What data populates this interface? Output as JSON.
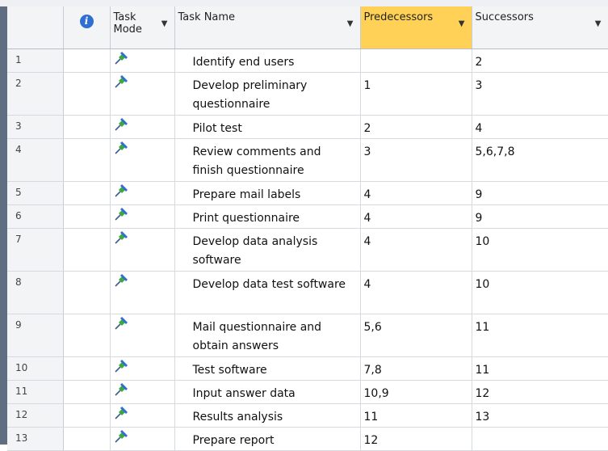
{
  "columns": {
    "task_mode": "Task Mode",
    "task_name": "Task Name",
    "predecessors": "Predecessors",
    "successors": "Successors"
  },
  "icons": {
    "header_info": "info-icon",
    "column_dropdown": "chevron-down-icon",
    "task_mode": "pushpin-icon"
  },
  "colors": {
    "selected_header": "#ffd257",
    "info_icon": "#2e6fd1",
    "pin_green": "#3da83d",
    "pin_blue": "#2e6fd1"
  },
  "tasks": [
    {
      "id": "1",
      "name": "Identify end users",
      "predecessors": "",
      "successors": "2"
    },
    {
      "id": "2",
      "name": "Develop preliminary questionnaire",
      "predecessors": "1",
      "successors": "3"
    },
    {
      "id": "3",
      "name": "Pilot test",
      "predecessors": "2",
      "successors": "4"
    },
    {
      "id": "4",
      "name": "Review comments and finish questionnaire",
      "predecessors": "3",
      "successors": "5,6,7,8"
    },
    {
      "id": "5",
      "name": "Prepare mail labels",
      "predecessors": "4",
      "successors": "9"
    },
    {
      "id": "6",
      "name": "Print questionnaire",
      "predecessors": "4",
      "successors": "9"
    },
    {
      "id": "7",
      "name": "Develop data analysis software",
      "predecessors": "4",
      "successors": "10"
    },
    {
      "id": "8",
      "name": "Develop data test software",
      "predecessors": "4",
      "successors": "10"
    },
    {
      "id": "9",
      "name": "Mail questionnaire and obtain answers",
      "predecessors": "5,6",
      "successors": "11"
    },
    {
      "id": "10",
      "name": "Test software",
      "predecessors": "7,8",
      "successors": "11"
    },
    {
      "id": "11",
      "name": "Input answer data",
      "predecessors": "10,9",
      "successors": "12"
    },
    {
      "id": "12",
      "name": "Results analysis",
      "predecessors": "11",
      "successors": "13"
    },
    {
      "id": "13",
      "name": "Prepare report",
      "predecessors": "12",
      "successors": ""
    }
  ]
}
